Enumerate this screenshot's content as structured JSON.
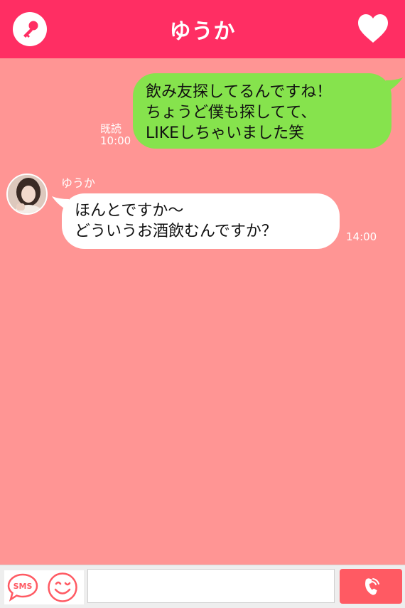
{
  "header": {
    "title": "ゆうか",
    "left_icon": "key-icon",
    "right_icon": "heart-icon",
    "color": "#ff2e63"
  },
  "chat": {
    "background": "#ff9594",
    "messages": [
      {
        "direction": "outgoing",
        "lines": [
          "飲み友探してるんですね！",
          "ちょうど僕も探してて、",
          "LIKEしちゃいました笑"
        ],
        "read_label": "既読",
        "time": "10:00",
        "bubble_color": "#86e34d"
      },
      {
        "direction": "incoming",
        "sender": "ゆうか",
        "lines": [
          "ほんとですか〜",
          "どういうお酒飲むんですか？"
        ],
        "time": "14:00",
        "bubble_color": "#ffffff"
      }
    ]
  },
  "input_bar": {
    "sms_label": "SMS",
    "sms_icon": "sms-icon",
    "emoji_icon": "smiley-icon",
    "message_value": "",
    "message_placeholder": "",
    "call_icon": "phone-icon",
    "call_color": "#ff5a63"
  }
}
